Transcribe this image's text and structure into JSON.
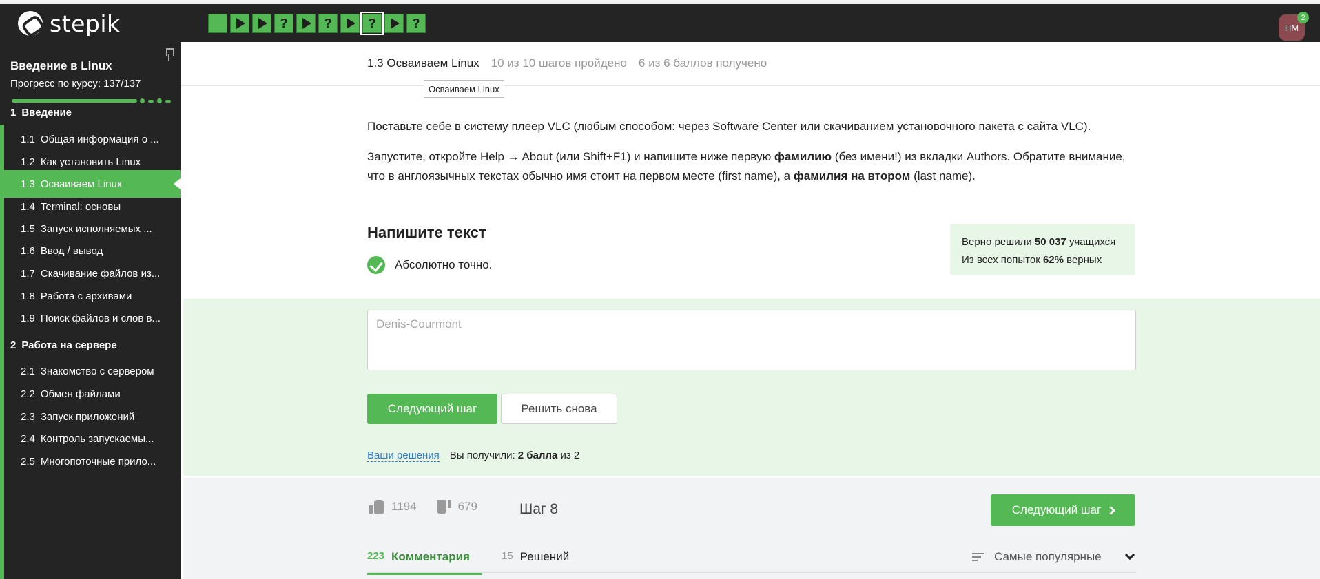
{
  "brand": {
    "name": "stepik"
  },
  "topbar": {
    "steps": [
      {
        "kind": "text",
        "done": true
      },
      {
        "kind": "video",
        "done": true
      },
      {
        "kind": "video",
        "done": true
      },
      {
        "kind": "quiz",
        "done": true
      },
      {
        "kind": "video",
        "done": true
      },
      {
        "kind": "quiz",
        "done": true
      },
      {
        "kind": "video",
        "done": true
      },
      {
        "kind": "quiz",
        "done": true,
        "active": true
      },
      {
        "kind": "video",
        "done": true
      },
      {
        "kind": "quiz",
        "done": true
      }
    ],
    "avatar_initials": "НМ",
    "notifications": "2"
  },
  "sidebar": {
    "course_title": "Введение в Linux",
    "progress_label": "Прогресс по курсу:  137/137",
    "progress": 1.0,
    "sections": [
      {
        "num": "1",
        "title": "Введение",
        "lessons": [
          {
            "num": "1.1",
            "title": "Общая информация о ..."
          },
          {
            "num": "1.2",
            "title": "Как установить Linux"
          },
          {
            "num": "1.3",
            "title": "Осваиваем Linux",
            "active": true
          },
          {
            "num": "1.4",
            "title": "Terminal: основы"
          },
          {
            "num": "1.5",
            "title": "Запуск исполняемых ..."
          },
          {
            "num": "1.6",
            "title": "Ввод / вывод"
          },
          {
            "num": "1.7",
            "title": "Скачивание файлов из..."
          },
          {
            "num": "1.8",
            "title": "Работа с архивами"
          },
          {
            "num": "1.9",
            "title": "Поиск файлов и слов в..."
          }
        ]
      },
      {
        "num": "2",
        "title": "Работа на сервере",
        "lessons": [
          {
            "num": "2.1",
            "title": "Знакомство с сервером"
          },
          {
            "num": "2.2",
            "title": "Обмен файлами"
          },
          {
            "num": "2.3",
            "title": "Запуск приложений"
          },
          {
            "num": "2.4",
            "title": "Контроль запускаемы..."
          },
          {
            "num": "2.5",
            "title": "Многопоточные прило..."
          }
        ]
      }
    ]
  },
  "lesson_header": {
    "name": "1.3 Осваиваем Linux",
    "steps_done": "10 из 10 шагов пройдено",
    "points": "6 из 6 баллов  получено",
    "tooltip": "Осваиваем Linux"
  },
  "content": {
    "p1": "Поставьте себе в систему плеер VLC (любым способом: через Software Center или скачиванием установочного пакета с сайта VLC).",
    "p2_a": "Запустите, откройте Help → About (или Shift+F1) и напишите ниже первую ",
    "p2_b": "фамилию",
    "p2_c": " (без имени!) из вкладки Authors. Обратите внимание, что в англоязычных текстах обычно имя стоит на первом месте (first name), а ",
    "p2_d": "фамилия на втором",
    "p2_e": " (last name)."
  },
  "quiz": {
    "title": "Напишите текст",
    "result": "Абсолютно точно.",
    "stats_line1_a": "Верно решили ",
    "stats_line1_b": "50 037",
    "stats_line1_c": " учащихся",
    "stats_line2_a": "Из всех попыток ",
    "stats_line2_b": "62%",
    "stats_line2_c": " верных",
    "answer": "Denis-Courmont",
    "next_label": "Следующий шаг",
    "retry_label": "Решить снова",
    "solutions_link": "Ваши решения",
    "score_a": "Вы получили: ",
    "score_b": "2 балла",
    "score_c": " из 2"
  },
  "footer": {
    "likes": "1194",
    "dislikes": "679",
    "step_label": "Шаг 8",
    "next_label": "Следующий шаг",
    "tabs": [
      {
        "count": "223",
        "label": "Комментария",
        "active": true
      },
      {
        "count": "15",
        "label": "Решений"
      }
    ],
    "sort_label": "Самые популярные"
  },
  "colors": {
    "accent": "#54b854",
    "dark": "#242424",
    "answer_bg": "#e7f6e6",
    "avatar": "#8a4a50"
  }
}
